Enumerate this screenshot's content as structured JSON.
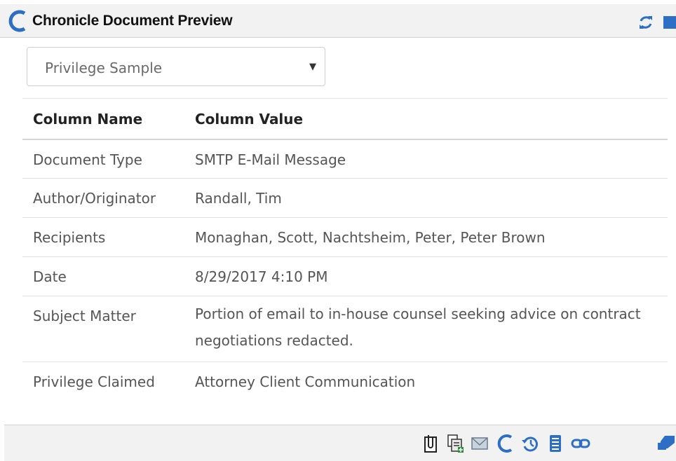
{
  "header": {
    "title": "Chronicle Document Preview"
  },
  "colors": {
    "brand_blue": "#2d6fc4",
    "header_bg": "#f2f2f2"
  },
  "selector": {
    "selected": "Privilege Sample"
  },
  "table": {
    "headers": [
      "Column Name",
      "Column Value"
    ],
    "rows": [
      {
        "name": "Document Type",
        "value": "SMTP E-Mail Message"
      },
      {
        "name": "Author/Originator",
        "value": "Randall, Tim"
      },
      {
        "name": "Recipients",
        "value": "Monaghan, Scott, Nachtsheim, Peter, Peter Brown"
      },
      {
        "name": "Date",
        "value": "8/29/2017 4:10 PM"
      },
      {
        "name": "Subject Matter",
        "value": "Portion of email to in-house counsel seeking advice on contract negotiations redacted."
      },
      {
        "name": "Privilege Claimed",
        "value": "Attorney Client Communication"
      }
    ]
  },
  "footer_icons": [
    "paperclip-icon",
    "document-add-icon",
    "email-icon",
    "chronicle-icon",
    "history-icon",
    "document-icon",
    "link-icon",
    "eraser-icon"
  ]
}
